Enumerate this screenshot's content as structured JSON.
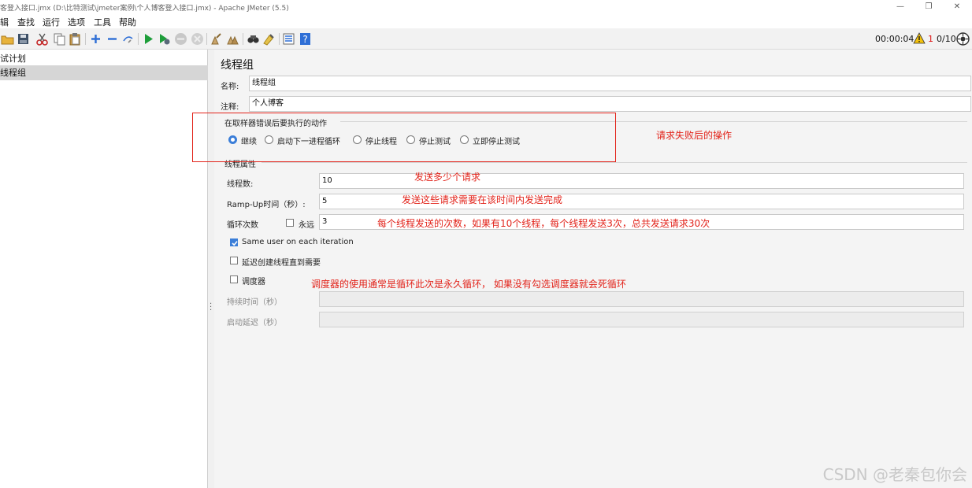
{
  "window": {
    "title": "客登入接口.jmx (D:\\比特测试\\jmeter案例\\个人博客登入接口.jmx) - Apache JMeter (5.5)",
    "minimize": "—",
    "restore": "❐",
    "close": "✕"
  },
  "menu": [
    "辑",
    "查找",
    "运行",
    "选项",
    "工具",
    "帮助"
  ],
  "toolbar": {
    "icons": [
      "open-icon",
      "save-icon",
      "cut-icon",
      "copy-icon",
      "paste-icon",
      "expand-icon",
      "collapse-icon",
      "toggle-icon",
      "start-icon",
      "start-no-pause-icon",
      "stop-icon",
      "shutdown-icon",
      "clear-icon",
      "clear-all-icon",
      "search-icon",
      "reset-search-icon",
      "function-helper-icon",
      "help-icon"
    ],
    "timer": "00:00:04",
    "warning_count": "1",
    "threads": "0/10"
  },
  "tree": {
    "items": [
      {
        "label": "试计划",
        "selected": false
      },
      {
        "label": "线程组",
        "selected": true
      }
    ]
  },
  "panel": {
    "title": "线程组",
    "name_label": "名称:",
    "name_value": "线程组",
    "comment_label": "注释:",
    "comment_value": "个人博客",
    "error_group_title": "在取样器错误后要执行的动作",
    "error_actions": [
      {
        "label": "继续",
        "selected": true
      },
      {
        "label": "启动下一进程循环",
        "selected": false
      },
      {
        "label": "停止线程",
        "selected": false
      },
      {
        "label": "停止测试",
        "selected": false
      },
      {
        "label": "立即停止测试",
        "selected": false
      }
    ],
    "props_title": "线程属性",
    "threads_label": "线程数:",
    "threads_value": "10",
    "rampup_label": "Ramp-Up时间（秒）:",
    "rampup_value": "5",
    "loop_label": "循环次数",
    "forever_label": "永远",
    "forever_checked": false,
    "loop_value": "3",
    "same_user_label": "Same user on each iteration",
    "same_user_checked": true,
    "delay_label": "延迟创建线程直到需要",
    "delay_checked": false,
    "scheduler_label": "调度器",
    "scheduler_checked": false,
    "duration_label": "持续时间（秒）",
    "duration_value": "",
    "startup_delay_label": "启动延迟（秒）",
    "startup_delay_value": ""
  },
  "annotations": {
    "error_action": "请求失败后的操作",
    "threads": "发送多少个请求",
    "rampup": "发送这些请求需要在该时间内发送完成",
    "loop": "每个线程发送的次数，如果有10个线程，每个线程发送3次，总共发送请求30次",
    "scheduler": "调度器的使用通常是循环此次是永久循环， 如果没有勾选调度器就会死循环"
  },
  "watermark": "CSDN @老秦包你会",
  "colors": {
    "annotation": "#e2231a",
    "accent": "#3b7ed8",
    "selection": "#d6d6d6"
  }
}
